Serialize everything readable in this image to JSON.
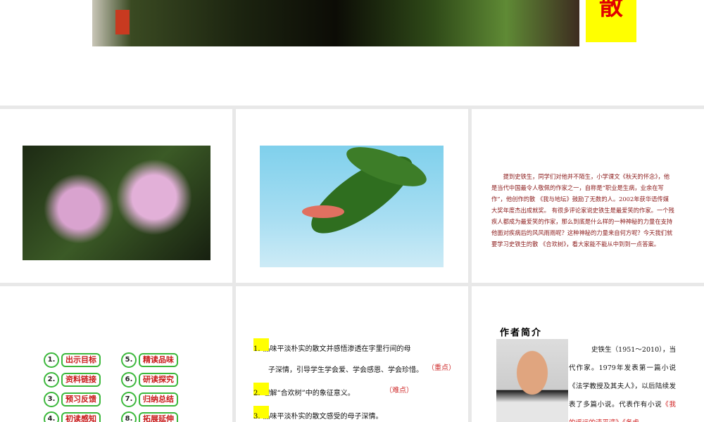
{
  "slide0": {
    "title_char": "散"
  },
  "slide3": {
    "paragraph": "提到史铁生，同学们对他并不陌生，小学课文《秋天的怀念》，他是当代中国最令人敬佩的作家之一，自称是“职业是生病，业余在写作”，他创作的散  《我与地坛》鼓励了无数的人。2002年获华语传媒大奖年度杰出成就奖。  有很多评论家说史铁生是最爱笑的作家。一个残疾人都成为最爱笑的作家，那么到底是什么样的一种神秘的力量在支持他面对疾病后的风风雨雨呢？这种神秘的力量来自何方呢？今天我们就要学习史铁生的散  《合欢树》，看大家能不能从中到到一点答案。"
  },
  "slide4": {
    "buttons": [
      {
        "num": "1.",
        "label": "出示目标"
      },
      {
        "num": "2.",
        "label": "资料链接"
      },
      {
        "num": "3.",
        "label": "预习反馈"
      },
      {
        "num": "4.",
        "label": "初读感知"
      },
      {
        "num": "5.",
        "label": "精读品味"
      },
      {
        "num": "6.",
        "label": "研读探究"
      },
      {
        "num": "7.",
        "label": "归纳总结"
      },
      {
        "num": "8.",
        "label": "拓展延伸"
      }
    ]
  },
  "slide5": {
    "objectives": [
      {
        "num": "1.",
        "line1": "品味平淡朴实的散文并感悟渗透在字里行间的母",
        "line2": "子深情，引导学生学会爱、学会感恩、学会珍惜。",
        "note": "（重点）"
      },
      {
        "num": "2.",
        "line1": "理解“合欢树”中的象征意义。",
        "note": "（难点）"
      },
      {
        "num": "3.",
        "line1": "品味平淡朴实的散文感受的母子深情。"
      }
    ]
  },
  "slide6": {
    "heading": "作者简介",
    "bio": "史铁生（1951～2010），当代作家。1979年发表第一篇小说《法学教授及其夫人》，以后陆续发表了多篇小说。代表作有小说",
    "bio_red": "《我的遥远的清平湾》《务虚"
  }
}
